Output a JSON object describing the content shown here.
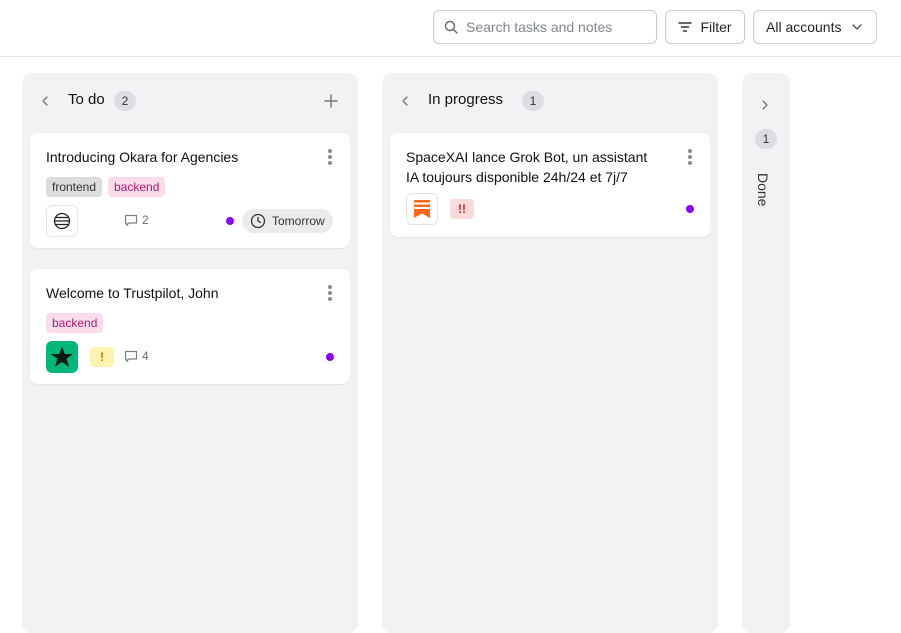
{
  "search": {
    "placeholder": "Search tasks and notes"
  },
  "toolbar": {
    "filter_label": "Filter",
    "accounts_label": "All accounts"
  },
  "columns": [
    {
      "title": "To do",
      "count": "2",
      "cards": [
        {
          "title": "Introducing Okara for Agencies",
          "tags": [
            "frontend",
            "backend"
          ],
          "comments": "2",
          "due": "Tomorrow"
        },
        {
          "title": "Welcome to Trustpilot, John",
          "tags": [
            "backend"
          ],
          "priority": "!",
          "comments": "4"
        }
      ]
    },
    {
      "title": "In progress",
      "count": "1",
      "cards": [
        {
          "title_line1": "SpaceXAI lance Grok Bot, un assistant",
          "title_line2": "IA toujours disponible 24h/24 et 7j/7",
          "priority": "!!"
        }
      ]
    },
    {
      "title": "Done",
      "count": "1"
    }
  ],
  "colors": {
    "status_dot": "#8a00f0",
    "tag_backend": "#fadcec",
    "trustpilot_green": "#00b67a",
    "substack_orange": "#ff6719"
  }
}
